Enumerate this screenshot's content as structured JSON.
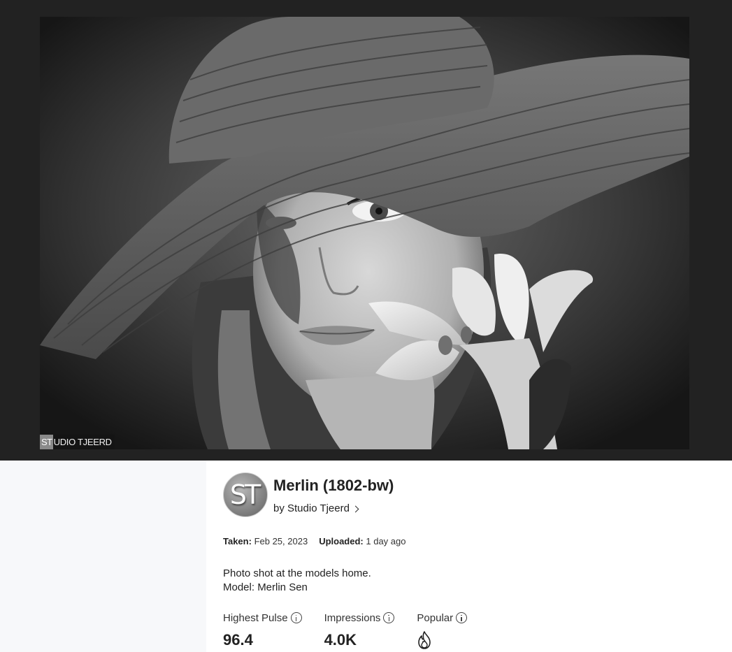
{
  "photo": {
    "alt_name": "Merlin (1802-bw)",
    "watermark_box": "ST",
    "watermark_rest": "UDIO TJEERD"
  },
  "author": {
    "avatar_initials": "ST",
    "byline": "by Studio Tjeerd"
  },
  "title": "Merlin (1802-bw)",
  "meta": {
    "taken_label": "Taken:",
    "taken_value": "Feb 25, 2023",
    "uploaded_label": "Uploaded:",
    "uploaded_value": "1 day ago"
  },
  "description": {
    "line1": "Photo shot at the models home.",
    "line2": "Model: Merlin Sen"
  },
  "stats": {
    "highest_pulse_label": "Highest Pulse",
    "highest_pulse_value": "96.4",
    "impressions_label": "Impressions",
    "impressions_value": "4.0K",
    "popular_label": "Popular",
    "popular_icon": "flame-icon"
  }
}
